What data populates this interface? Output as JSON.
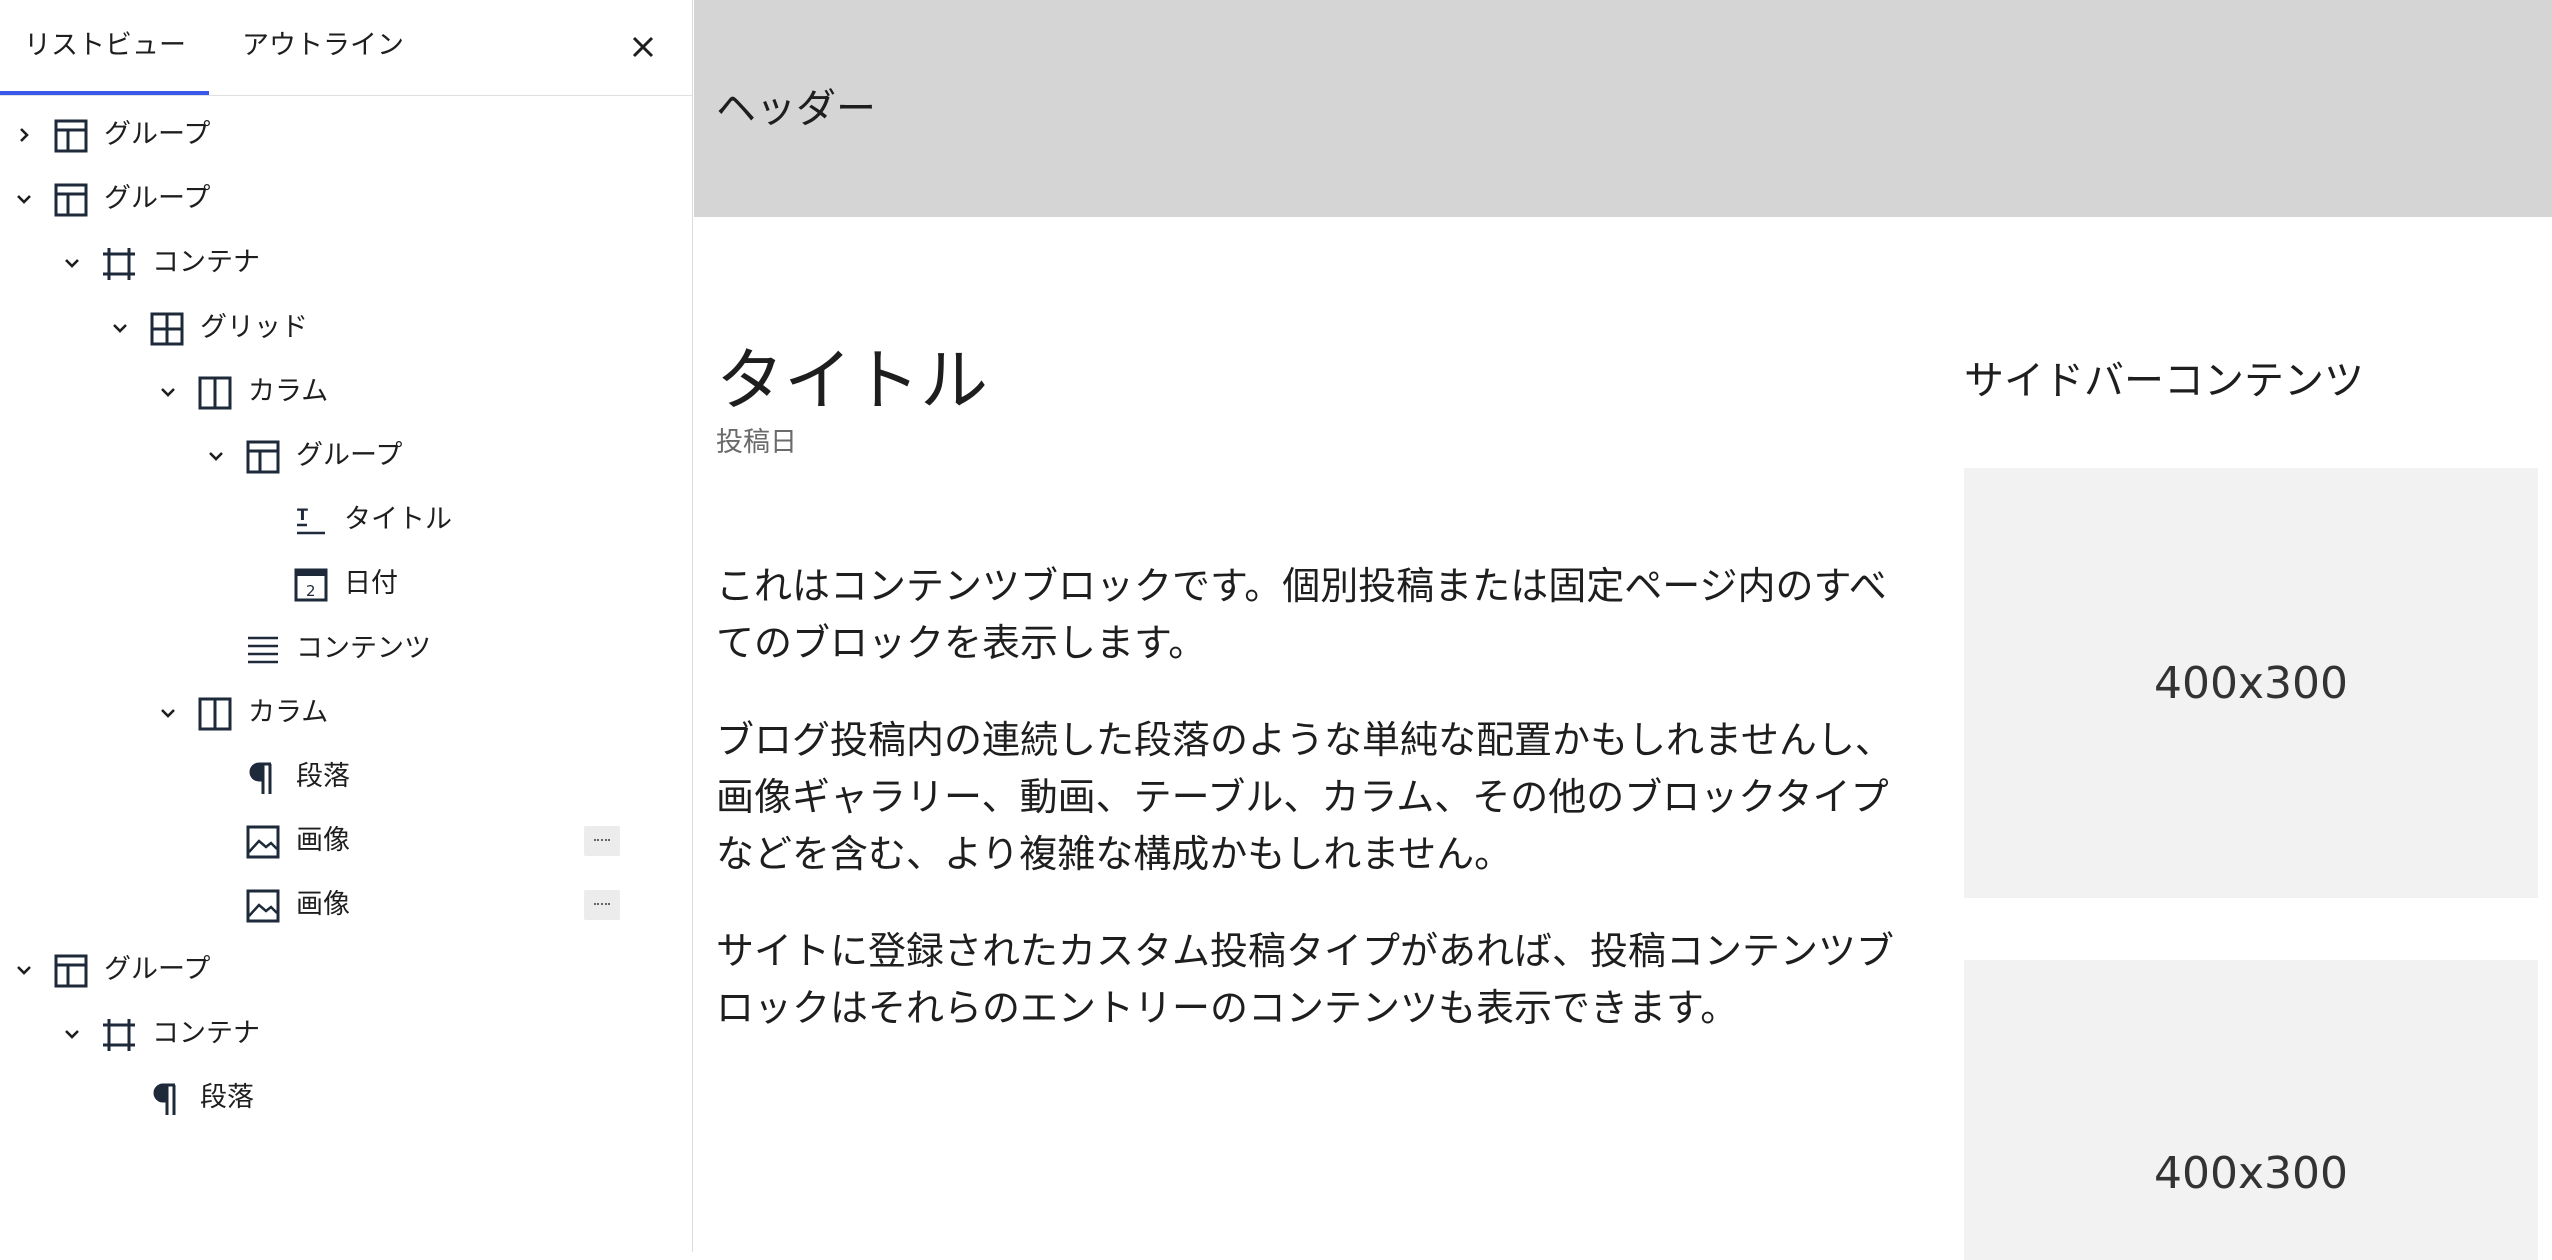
{
  "panel": {
    "tabs": [
      {
        "label": "リストビュー",
        "active": true
      },
      {
        "label": "アウトライン",
        "active": false
      }
    ],
    "close_icon": "close-icon"
  },
  "tree": [
    {
      "label": "グループ",
      "icon": "group-icon",
      "depth": 0,
      "expanded": false,
      "has_children": true
    },
    {
      "label": "グループ",
      "icon": "group-icon",
      "depth": 0,
      "expanded": true,
      "has_children": true
    },
    {
      "label": "コンテナ",
      "icon": "container-icon",
      "depth": 1,
      "expanded": true,
      "has_children": true
    },
    {
      "label": "グリッド",
      "icon": "grid-icon",
      "depth": 2,
      "expanded": true,
      "has_children": true
    },
    {
      "label": "カラム",
      "icon": "column-icon",
      "depth": 3,
      "expanded": true,
      "has_children": true
    },
    {
      "label": "グループ",
      "icon": "group-icon",
      "depth": 4,
      "expanded": true,
      "has_children": true
    },
    {
      "label": "タイトル",
      "icon": "title-icon",
      "depth": 5,
      "has_children": false
    },
    {
      "label": "日付",
      "icon": "calendar-icon",
      "depth": 5,
      "has_children": false
    },
    {
      "label": "コンテンツ",
      "icon": "content-icon",
      "depth": 4,
      "has_children": false
    },
    {
      "label": "カラム",
      "icon": "column-icon",
      "depth": 3,
      "expanded": true,
      "has_children": true
    },
    {
      "label": "段落",
      "icon": "paragraph-icon",
      "depth": 4,
      "has_children": false
    },
    {
      "label": "画像",
      "icon": "image-icon",
      "depth": 4,
      "has_children": false,
      "options": true
    },
    {
      "label": "画像",
      "icon": "image-icon",
      "depth": 4,
      "has_children": false,
      "options": true
    },
    {
      "label": "グループ",
      "icon": "group-icon",
      "depth": 0,
      "expanded": true,
      "has_children": true
    },
    {
      "label": "コンテナ",
      "icon": "container-icon",
      "depth": 1,
      "expanded": true,
      "has_children": true
    },
    {
      "label": "段落",
      "icon": "paragraph-icon",
      "depth": 2,
      "has_children": false
    }
  ],
  "canvas": {
    "header": "ヘッダー",
    "title": "タイトル",
    "date": "投稿日",
    "paragraphs": [
      "これはコンテンツブロックです。個別投稿または固定ページ内のすべてのブロックを表示します。",
      "ブログ投稿内の連続した段落のような単純な配置かもしれませんし、画像ギャラリー、動画、テーブル、カラム、その他のブロックタイプなどを含む、より複雑な構成かもしれません。",
      "サイトに登録されたカスタム投稿タイプがあれば、投稿コンテンツブロックはそれらのエントリーのコンテンツも表示できます。"
    ],
    "sidebar_title": "サイドバーコンテンツ",
    "placeholders": [
      "400x300",
      "400x300"
    ]
  },
  "colors": {
    "icon": "#1e2a3a",
    "header_bg": "#d5d5d5",
    "placeholder_bg": "#f2f2f2",
    "tab_underline": "#2f6e7a"
  }
}
